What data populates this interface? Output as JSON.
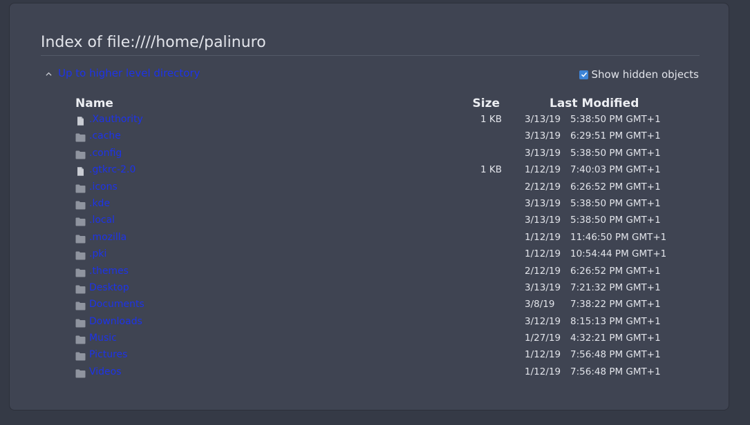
{
  "page": {
    "title": "Index of file:////home/palinuro",
    "up_link_label": "Up to higher level directory",
    "show_hidden_label": "Show hidden objects",
    "show_hidden_checked": true
  },
  "columns": {
    "name": "Name",
    "size": "Size",
    "last_modified": "Last Modified"
  },
  "colors": {
    "link": "#1d33e8",
    "checkbox": "#3d84d6",
    "folder_icon": "#8f949f",
    "file_icon": "#c9ccd3"
  },
  "entries": [
    {
      "name": ".Xauthority",
      "type": "file",
      "icon": "file-icon",
      "size": "1 KB",
      "date": "3/13/19",
      "time": "5:38:50 PM GMT+1"
    },
    {
      "name": ".cache",
      "type": "folder",
      "icon": "folder-icon",
      "size": "",
      "date": "3/13/19",
      "time": "6:29:51 PM GMT+1"
    },
    {
      "name": ".config",
      "type": "folder",
      "icon": "folder-icon",
      "size": "",
      "date": "3/13/19",
      "time": "5:38:50 PM GMT+1"
    },
    {
      "name": ".gtkrc-2.0",
      "type": "file",
      "icon": "file-icon",
      "size": "1 KB",
      "date": "1/12/19",
      "time": "7:40:03 PM GMT+1"
    },
    {
      "name": ".icons",
      "type": "folder",
      "icon": "folder-icon",
      "size": "",
      "date": "2/12/19",
      "time": "6:26:52 PM GMT+1"
    },
    {
      "name": ".kde",
      "type": "folder",
      "icon": "folder-icon",
      "size": "",
      "date": "3/13/19",
      "time": "5:38:50 PM GMT+1"
    },
    {
      "name": ".local",
      "type": "folder",
      "icon": "folder-icon",
      "size": "",
      "date": "3/13/19",
      "time": "5:38:50 PM GMT+1"
    },
    {
      "name": ".mozilla",
      "type": "folder",
      "icon": "folder-icon",
      "size": "",
      "date": "1/12/19",
      "time": "11:46:50 PM GMT+1"
    },
    {
      "name": ".pki",
      "type": "folder",
      "icon": "folder-icon",
      "size": "",
      "date": "1/12/19",
      "time": "10:54:44 PM GMT+1"
    },
    {
      "name": ".themes",
      "type": "folder",
      "icon": "folder-icon",
      "size": "",
      "date": "2/12/19",
      "time": "6:26:52 PM GMT+1"
    },
    {
      "name": "Desktop",
      "type": "folder",
      "icon": "folder-icon",
      "size": "",
      "date": "3/13/19",
      "time": "7:21:32 PM GMT+1"
    },
    {
      "name": "Documents",
      "type": "folder",
      "icon": "folder-icon",
      "size": "",
      "date": "3/8/19",
      "time": "7:38:22 PM GMT+1"
    },
    {
      "name": "Downloads",
      "type": "folder",
      "icon": "folder-icon",
      "size": "",
      "date": "3/12/19",
      "time": "8:15:13 PM GMT+1"
    },
    {
      "name": "Music",
      "type": "folder",
      "icon": "folder-icon",
      "size": "",
      "date": "1/27/19",
      "time": "4:32:21 PM GMT+1"
    },
    {
      "name": "Pictures",
      "type": "folder",
      "icon": "folder-icon",
      "size": "",
      "date": "1/12/19",
      "time": "7:56:48 PM GMT+1"
    },
    {
      "name": "Videos",
      "type": "folder",
      "icon": "folder-icon",
      "size": "",
      "date": "1/12/19",
      "time": "7:56:48 PM GMT+1"
    }
  ]
}
